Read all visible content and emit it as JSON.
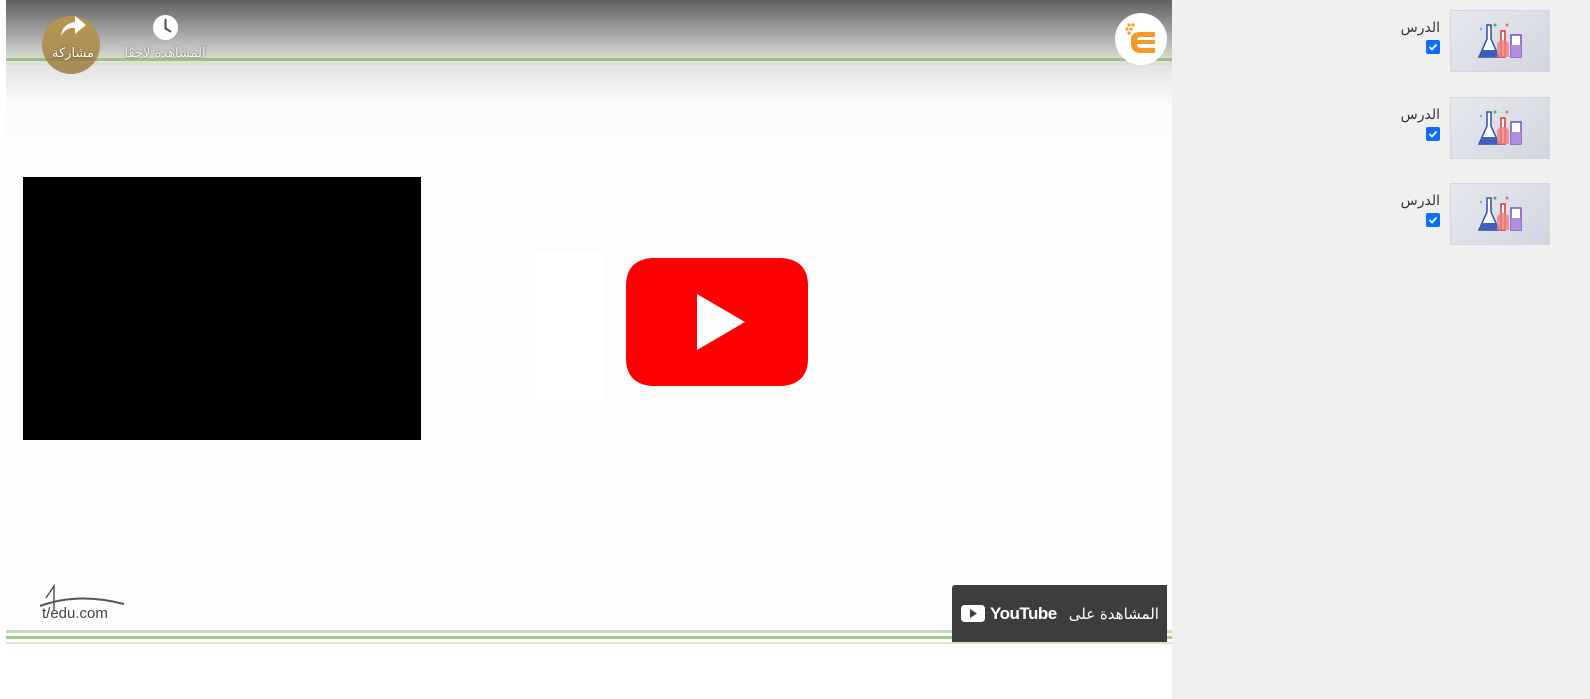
{
  "player": {
    "watch_later_label": "المشاهدة لاحقًا",
    "share_label": "مشاركة",
    "watch_on_label": "المشاهدة على",
    "youtube_wordmark": "YouTube",
    "tedu_logo_text": "t/edu.com",
    "icons": {
      "channel_logo": "channel-logo-icon",
      "watch_later": "clock-icon",
      "share": "share-arrow-icon",
      "play": "youtube-play-icon",
      "youtube_small": "youtube-logo-icon"
    },
    "colors": {
      "youtube_red": "#ff0000",
      "logo_orange": "#f39a2b",
      "overlay_dark": "#3d3d3d",
      "stripe_green": "#9fbf87"
    }
  },
  "sidebar": {
    "lessons": [
      {
        "title": "الدرس",
        "checked": true
      },
      {
        "title": "الدرس",
        "checked": true
      },
      {
        "title": "الدرس",
        "checked": true
      }
    ],
    "thumb_icon": "lab-flasks-icon",
    "checkbox_color": "#0d6efd"
  }
}
